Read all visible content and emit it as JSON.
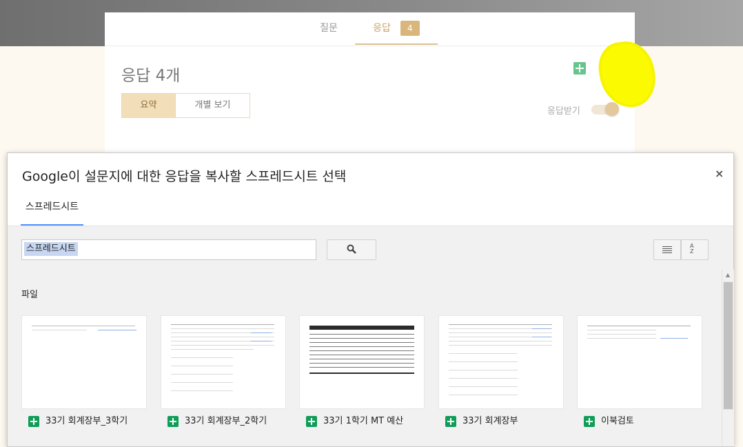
{
  "background_form": {
    "tabs": [
      {
        "label": "질문"
      },
      {
        "label": "응답",
        "badge": "4"
      }
    ],
    "title": "응답 4개",
    "segment": {
      "summary": "요약",
      "individual": "개별 보기"
    },
    "accept_label": "응답받기"
  },
  "dialog": {
    "title": "Google이 설문지에 대한 응답을 복사할 스프레드시트 선택",
    "close": "×",
    "tab": "스프레드시트",
    "search": {
      "value": "스프레드시트"
    },
    "files_label": "파일",
    "files": [
      {
        "name": "33기 회계장부_3학기"
      },
      {
        "name": "33기 회계장부_2학기"
      },
      {
        "name": "33기 1학기 MT 예산"
      },
      {
        "name": "33기 회계장부"
      },
      {
        "name": "이북검토"
      }
    ]
  },
  "colors": {
    "accent": "#4d90fe",
    "sheets_green": "#0f9d58",
    "form_gold": "#d9b77c",
    "highlight": "#fbfa00"
  },
  "icons": [
    "sheets-add-icon",
    "more-vert-icon",
    "search-icon",
    "list-view-icon",
    "sort-az-icon",
    "sheets-file-icon"
  ]
}
